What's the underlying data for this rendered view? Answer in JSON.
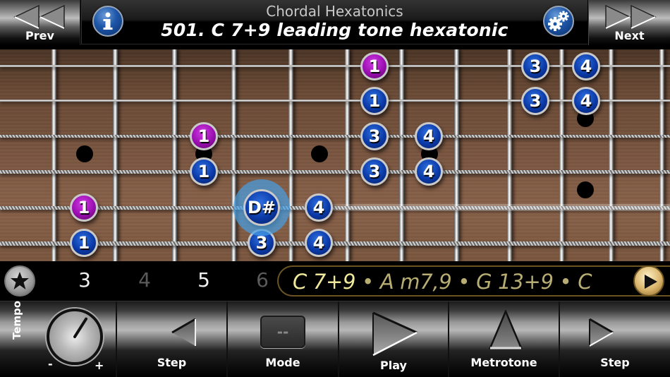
{
  "header": {
    "prev_label": "Prev",
    "next_label": "Next",
    "subtitle": "Chordal Hexatonics",
    "title": "501. C 7+9 leading tone hexatonic",
    "info_icon": "info-icon",
    "settings_icon": "gear-icon"
  },
  "fretboard": {
    "frets_visible": 12,
    "strings": 6,
    "inlay_markers": [
      {
        "string_gap": "3-4",
        "between_frets": [
          1,
          2
        ]
      },
      {
        "string_gap": "3-4",
        "between_frets": [
          3,
          4
        ]
      },
      {
        "string_gap": "3-4",
        "between_frets": [
          5,
          6
        ]
      },
      {
        "string_gap": "3-4",
        "between_frets": [
          7,
          8
        ]
      },
      {
        "string_gap": "2-3",
        "between_frets": [
          9,
          10
        ]
      },
      {
        "string_gap": "4-5",
        "between_frets": [
          9,
          10
        ]
      }
    ],
    "notes": [
      {
        "string": 1,
        "slot": 6,
        "label": "1",
        "color": "magenta"
      },
      {
        "string": 1,
        "slot": 9,
        "label": "3",
        "color": "blue"
      },
      {
        "string": 1,
        "slot": 10,
        "label": "4",
        "color": "blue"
      },
      {
        "string": 2,
        "slot": 6,
        "label": "1",
        "color": "blue"
      },
      {
        "string": 2,
        "slot": 9,
        "label": "3",
        "color": "blue"
      },
      {
        "string": 2,
        "slot": 10,
        "label": "4",
        "color": "blue"
      },
      {
        "string": 3,
        "slot": 3,
        "label": "1",
        "color": "magenta"
      },
      {
        "string": 3,
        "slot": 6,
        "label": "3",
        "color": "blue"
      },
      {
        "string": 3,
        "slot": 7,
        "label": "4",
        "color": "blue"
      },
      {
        "string": 4,
        "slot": 3,
        "label": "1",
        "color": "blue"
      },
      {
        "string": 4,
        "slot": 6,
        "label": "3",
        "color": "blue"
      },
      {
        "string": 4,
        "slot": 7,
        "label": "4",
        "color": "blue"
      },
      {
        "string": 5,
        "slot": 1,
        "label": "1",
        "color": "magenta"
      },
      {
        "string": 5,
        "slot": 4,
        "label": "D#",
        "color": "blue",
        "active": true
      },
      {
        "string": 5,
        "slot": 5,
        "label": "4",
        "color": "blue"
      },
      {
        "string": 6,
        "slot": 1,
        "label": "1",
        "color": "blue"
      },
      {
        "string": 6,
        "slot": 4,
        "label": "3",
        "color": "blue"
      },
      {
        "string": 6,
        "slot": 5,
        "label": "4",
        "color": "blue"
      }
    ],
    "colors": {
      "magenta": "#9a0fb0",
      "blue": "#0b3aa8",
      "active_glow": "#46a0e6"
    }
  },
  "strip": {
    "favorite_icon": "star-icon",
    "positions": [
      {
        "label": "3",
        "state": "bright"
      },
      {
        "label": "4",
        "state": "dim"
      },
      {
        "label": "5",
        "state": "bright"
      },
      {
        "label": "6",
        "state": "dim"
      }
    ],
    "chords": {
      "current": "C 7+9",
      "rest": " • A m7,9 • G 13+9 • C"
    },
    "chord_play_icon": "play-icon",
    "colors": {
      "current": "#f1e99a",
      "rest": "#b8ad72",
      "border": "#6b5422"
    }
  },
  "toolbar": {
    "tempo_label": "Tempo",
    "tempo_minus": "-",
    "tempo_plus": "+",
    "tempo_knob_value": 0.62,
    "step_back_label": "Step",
    "mode_label": "Mode",
    "mode_display": "--",
    "play_label": "Play",
    "metrotone_label": "Metrotone",
    "step_forward_label": "Step"
  }
}
